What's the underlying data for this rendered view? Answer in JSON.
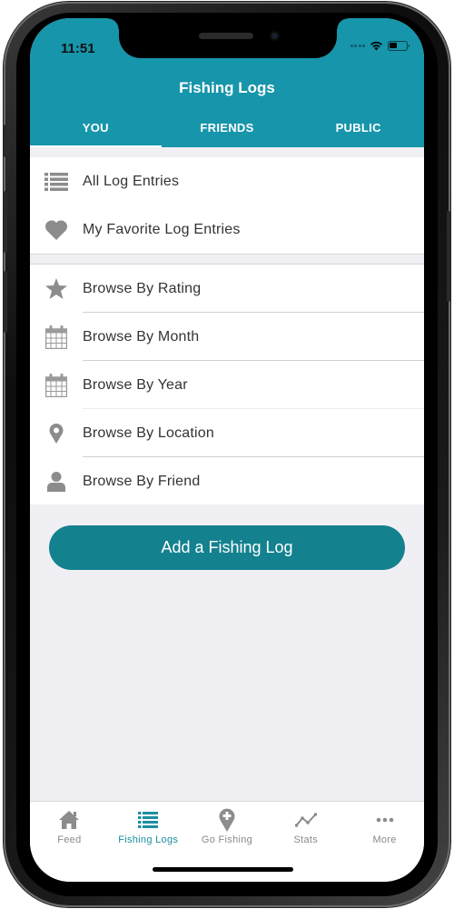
{
  "status_bar": {
    "time": "11:51"
  },
  "header": {
    "title": "Fishing Logs",
    "tabs": [
      {
        "label": "YOU",
        "active": true
      },
      {
        "label": "FRIENDS",
        "active": false
      },
      {
        "label": "PUBLIC",
        "active": false
      }
    ]
  },
  "sections": [
    {
      "items": [
        {
          "label": "All Log Entries",
          "icon": "list-icon"
        },
        {
          "label": "My Favorite Log Entries",
          "icon": "heart-icon"
        }
      ]
    },
    {
      "items": [
        {
          "label": "Browse By Rating",
          "icon": "star-icon"
        },
        {
          "label": "Browse By Month",
          "icon": "calendar-icon"
        },
        {
          "label": "Browse By Year",
          "icon": "calendar-icon"
        },
        {
          "label": "Browse By Location",
          "icon": "map-pin-icon"
        },
        {
          "label": "Browse By Friend",
          "icon": "person-icon"
        }
      ]
    }
  ],
  "add_button": {
    "label": "Add a Fishing Log"
  },
  "tabbar": {
    "items": [
      {
        "label": "Feed",
        "icon": "home-icon",
        "active": false
      },
      {
        "label": "Fishing Logs",
        "icon": "list-icon",
        "active": true
      },
      {
        "label": "Go Fishing",
        "icon": "map-pin-plus-icon",
        "active": false
      },
      {
        "label": "Stats",
        "icon": "line-chart-icon",
        "active": false
      },
      {
        "label": "More",
        "icon": "more-dots-icon",
        "active": false
      }
    ]
  },
  "colors": {
    "header": "#1795aa",
    "button": "#14818f",
    "active_tab": "#1c8ea0",
    "icon_gray": "#8c8c8c",
    "background": "#efeff4"
  }
}
